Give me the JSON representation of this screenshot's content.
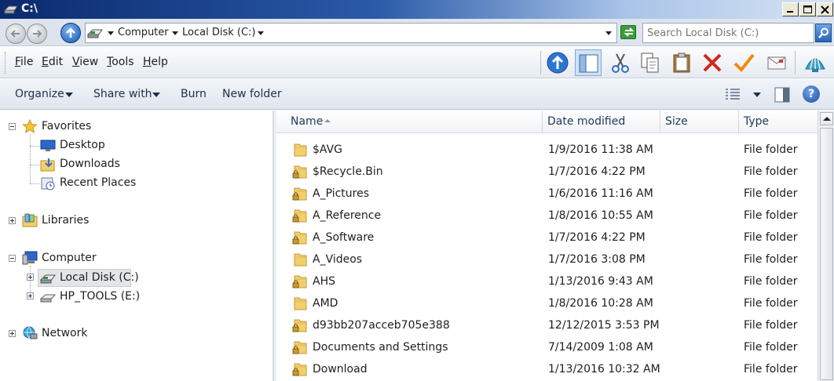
{
  "window": {
    "title": "C:\\"
  },
  "address": {
    "segments": [
      "Computer",
      "Local Disk (C:)"
    ]
  },
  "search": {
    "placeholder": "Search Local Disk (C:)"
  },
  "menu": [
    {
      "label": "File",
      "key": "F",
      "rest": "ile"
    },
    {
      "label": "Edit",
      "key": "E",
      "rest": "dit"
    },
    {
      "label": "View",
      "key": "V",
      "rest": "iew"
    },
    {
      "label": "Tools",
      "key": "T",
      "rest": "ools"
    },
    {
      "label": "Help",
      "key": "H",
      "rest": "elp"
    }
  ],
  "toolbar_icons": [
    "up-folder-icon",
    "pane-toggle-icon",
    "cut-icon",
    "copy-icon",
    "paste-icon",
    "delete-icon",
    "check-icon",
    "email-icon",
    "seashell-icon"
  ],
  "commands": {
    "organize": "Organize",
    "share": "Share with",
    "burn": "Burn",
    "new_folder": "New folder"
  },
  "nav": {
    "favorites": "Favorites",
    "desktop": "Desktop",
    "downloads": "Downloads",
    "recent": "Recent Places",
    "libraries": "Libraries",
    "computer": "Computer",
    "local_disk": "Local Disk (C:)",
    "hp_tools": "HP_TOOLS (E:)",
    "network": "Network"
  },
  "columns": {
    "name": "Name",
    "date": "Date modified",
    "size": "Size",
    "type": "Type"
  },
  "files": [
    {
      "name": "$AVG",
      "date": "1/9/2016 11:38 AM",
      "type": "File folder",
      "locked": false
    },
    {
      "name": "$Recycle.Bin",
      "date": "1/7/2016 4:22 PM",
      "type": "File folder",
      "locked": true
    },
    {
      "name": "A_Pictures",
      "date": "1/6/2016 11:16 AM",
      "type": "File folder",
      "locked": true
    },
    {
      "name": "A_Reference",
      "date": "1/8/2016 10:55 AM",
      "type": "File folder",
      "locked": true
    },
    {
      "name": "A_Software",
      "date": "1/7/2016 4:22 PM",
      "type": "File folder",
      "locked": true
    },
    {
      "name": "A_Videos",
      "date": "1/7/2016 3:08 PM",
      "type": "File folder",
      "locked": false
    },
    {
      "name": "AHS",
      "date": "1/13/2016 9:43 AM",
      "type": "File folder",
      "locked": true
    },
    {
      "name": "AMD",
      "date": "1/8/2016 10:28 AM",
      "type": "File folder",
      "locked": false
    },
    {
      "name": "d93bb207acceb705e388",
      "date": "12/12/2015 3:53 PM",
      "type": "File folder",
      "locked": true
    },
    {
      "name": "Documents and Settings",
      "date": "7/14/2009 1:08 AM",
      "type": "File folder",
      "locked": true
    },
    {
      "name": "Download",
      "date": "1/13/2016 10:32 AM",
      "type": "File folder",
      "locked": true
    }
  ],
  "colors": {
    "title_dark": "#0b2a6e",
    "folder": "#f3cf6b",
    "selected": "#e3e5e8"
  }
}
